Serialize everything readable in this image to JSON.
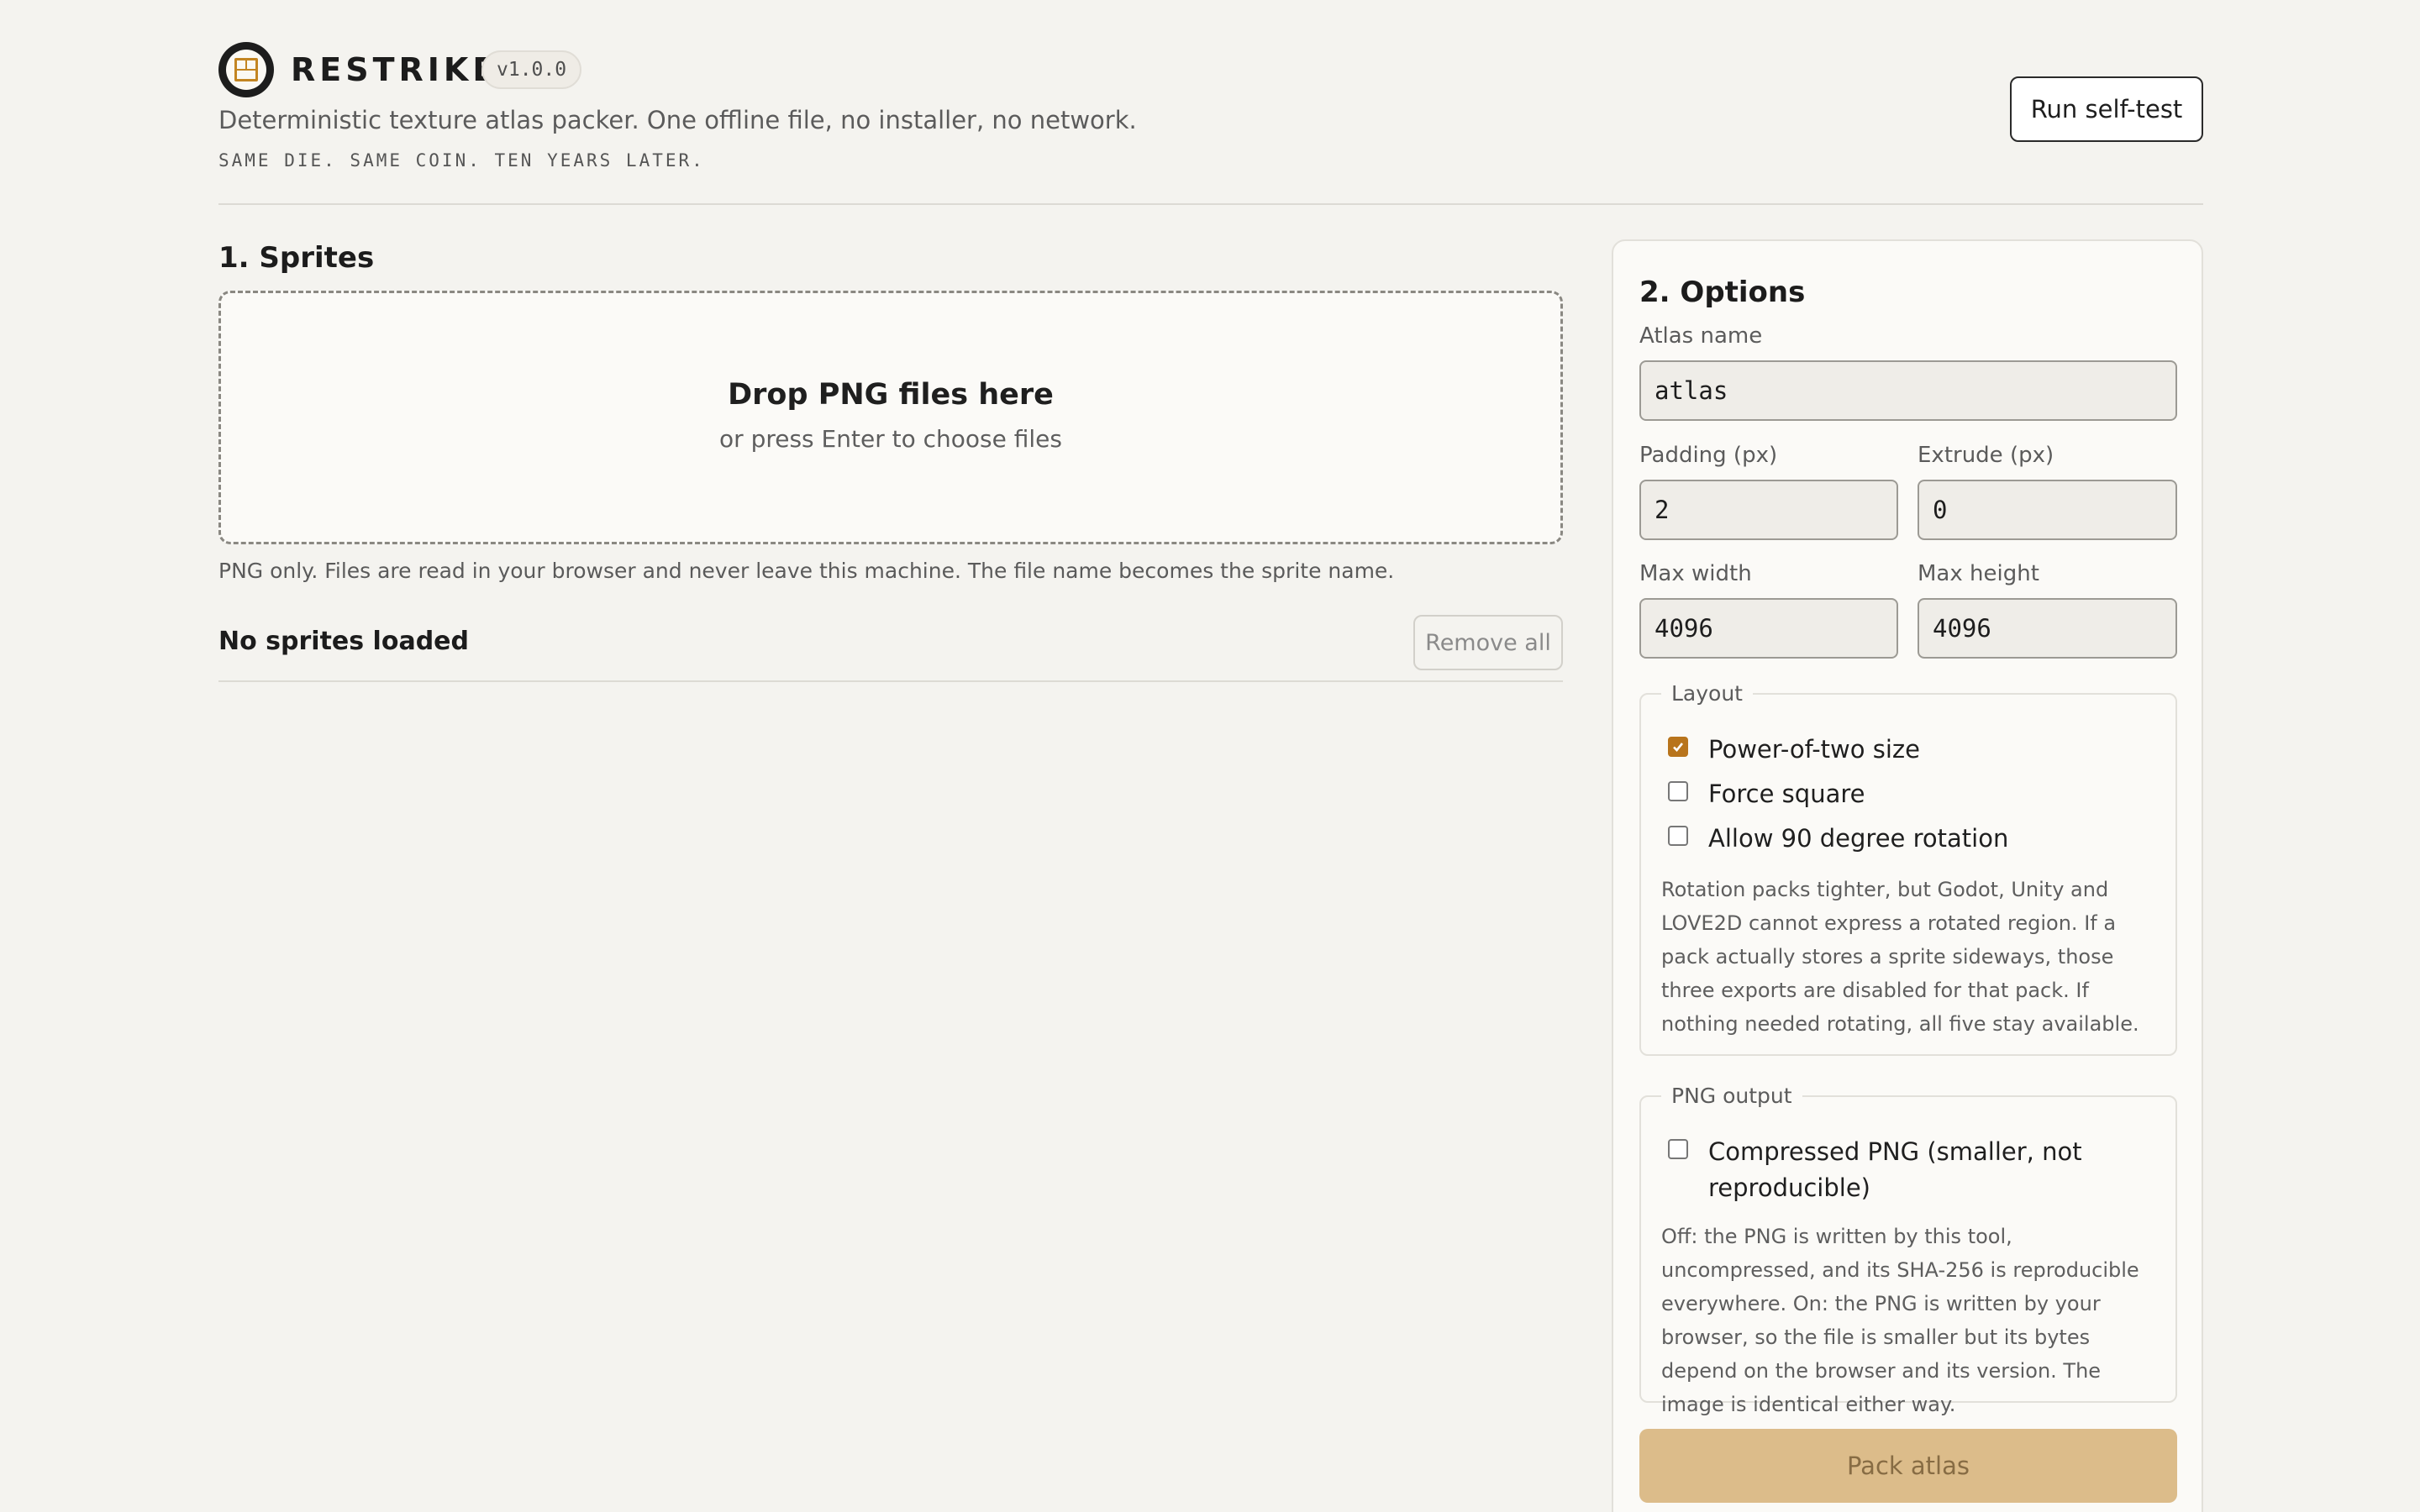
{
  "header": {
    "brand": "RESTRIKE",
    "version": "v1.0.0",
    "tagline": "Deterministic texture atlas packer. One offline file, no installer, no network.",
    "motto": "SAME DIE. SAME COIN. TEN YEARS LATER.",
    "self_test_label": "Run self-test"
  },
  "sprites": {
    "title": "1. Sprites",
    "drop_title": "Drop PNG files here",
    "drop_sub": "or press Enter to choose files",
    "note": "PNG only. Files are read in your browser and never leave this machine. The file name becomes the sprite name.",
    "list_title": "No sprites loaded",
    "remove_all_label": "Remove all"
  },
  "options": {
    "title": "2. Options",
    "atlas_name_label": "Atlas name",
    "atlas_name_value": "atlas",
    "padding_label": "Padding (px)",
    "padding_value": "2",
    "extrude_label": "Extrude (px)",
    "extrude_value": "0",
    "max_width_label": "Max width",
    "max_width_value": "4096",
    "max_height_label": "Max height",
    "max_height_value": "4096",
    "layout": {
      "legend": "Layout",
      "power_of_two": {
        "label": "Power-of-two size",
        "checked": true
      },
      "force_square": {
        "label": "Force square",
        "checked": false
      },
      "rotation": {
        "label": "Allow 90 degree rotation",
        "checked": false
      },
      "help": "Rotation packs tighter, but Godot, Unity and LOVE2D cannot express a rotated region. If a pack actually stores a sprite sideways, those three exports are disabled for that pack. If nothing needed rotating, all five stay available."
    },
    "png_output": {
      "legend": "PNG output",
      "compressed": {
        "label": "Compressed PNG (smaller, not reproducible)",
        "checked": false
      },
      "help": "Off: the PNG is written by this tool, uncompressed, and its SHA-256 is reproducible everywhere. On: the PNG is written by your browser, so the file is smaller but its bytes depend on the browser and its version. The image is identical either way."
    },
    "pack_label": "Pack atlas"
  },
  "colors": {
    "accent": "#b8741c",
    "pack_disabled_bg": "#dcbc8a",
    "background": "#f4f3ef"
  }
}
